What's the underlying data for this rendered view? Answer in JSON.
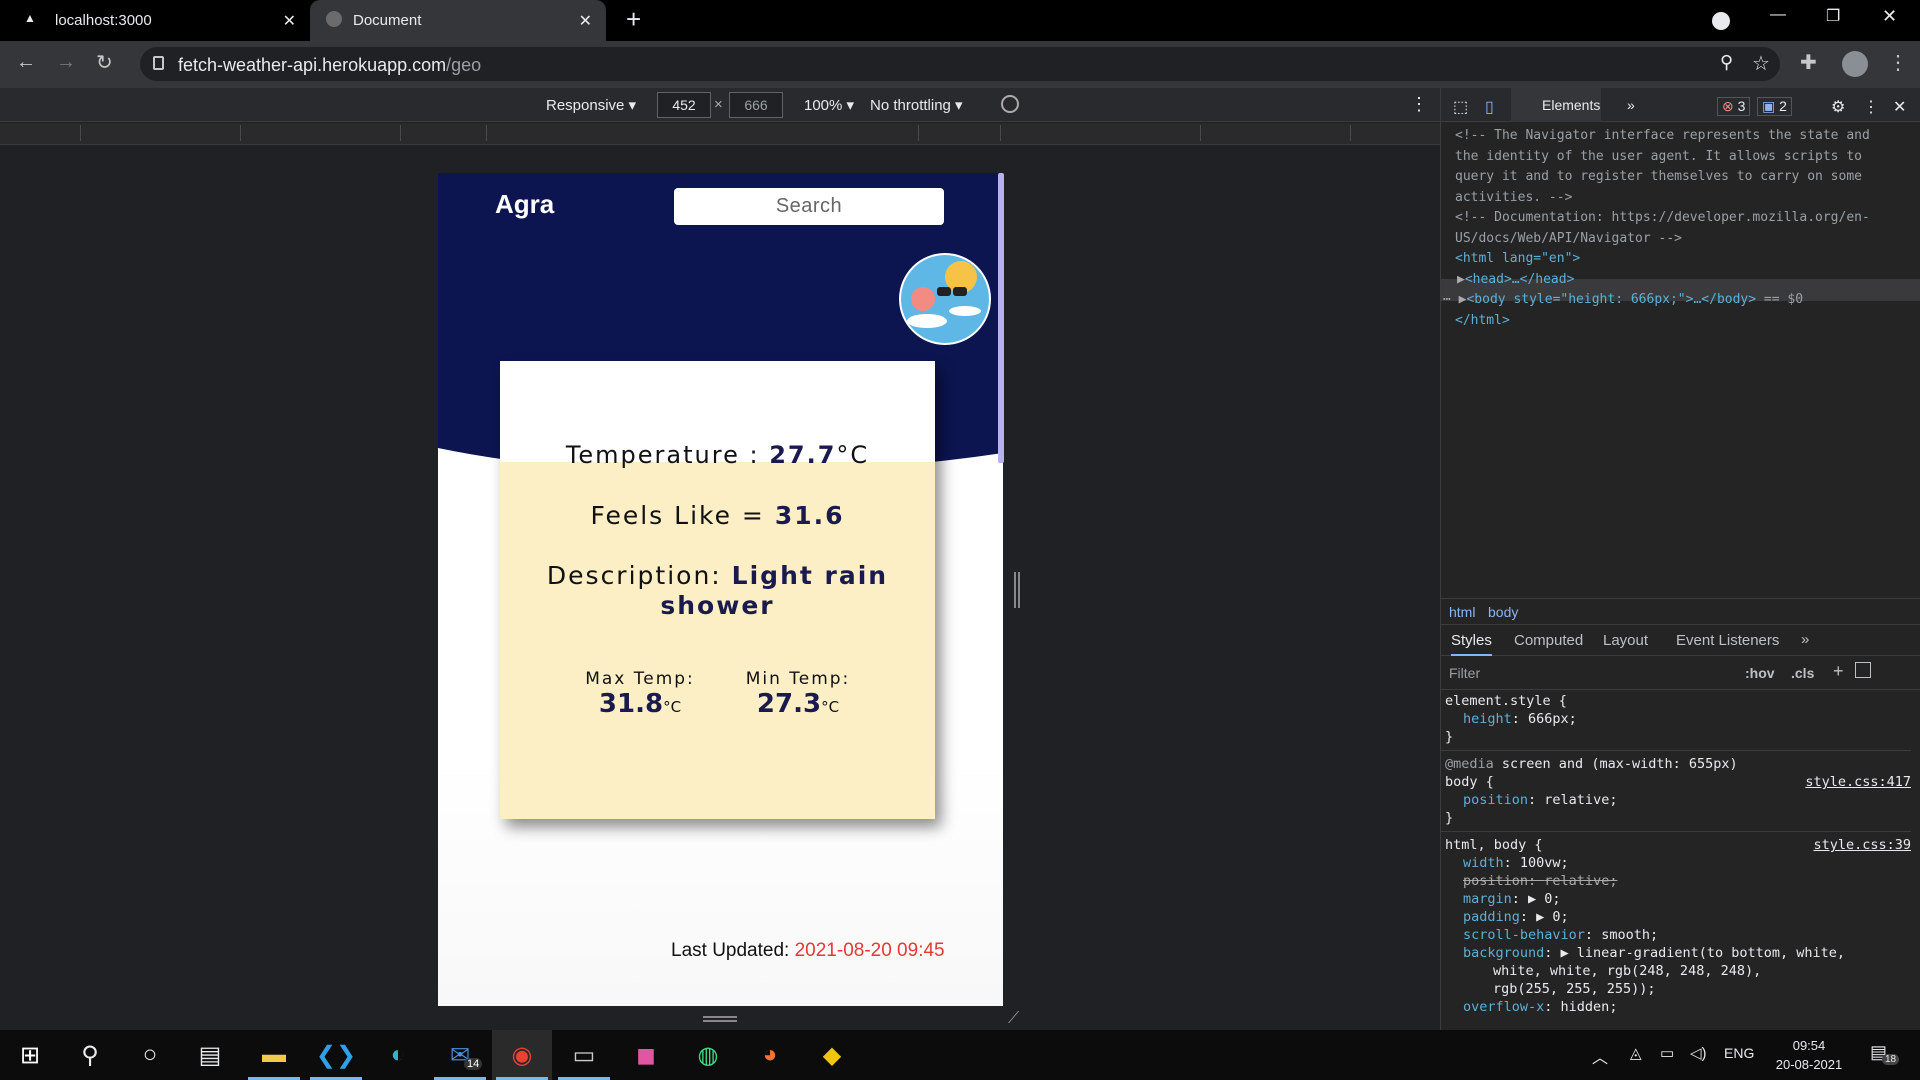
{
  "browser": {
    "tabs": [
      {
        "label": "localhost:3000",
        "close": "✕"
      },
      {
        "label": "Document",
        "close": "✕"
      }
    ],
    "new_tab": "+",
    "url_host": "fetch-weather-api.herokuapp.com",
    "url_path": "/geo"
  },
  "device_toolbar": {
    "preset": "Responsive",
    "width": "452",
    "times": "×",
    "height": "666",
    "zoom": "100%",
    "throttling": "No throttling"
  },
  "app": {
    "city": "Agra",
    "search_placeholder": "Search",
    "temperature_label": "Temperature :",
    "temperature_value": "27.7",
    "temperature_unit": "°C",
    "feels_like_label": "Feels Like =",
    "feels_like_value": "31.6",
    "description_label": "Description:",
    "description_value_line1": "Light rain",
    "description_value_line2": "shower",
    "max_label": "Max Temp:",
    "max_value": "31.8",
    "min_label": "Min Temp:",
    "min_value": "27.3",
    "unit_small": "°C",
    "last_updated_label": "Last Updated:",
    "last_updated_value": "2021-08-20 09:45"
  },
  "devtools": {
    "panel": "Elements",
    "more": "»",
    "errors": "3",
    "messages": "2",
    "dom_lines": [
      "<!-- The Navigator interface represents the state and",
      "the identity of the user agent. It allows scripts to",
      "query it and to register themselves to carry on some",
      "activities. -->",
      "<!-- Documentation: https://developer.mozilla.org/en-",
      "US/docs/Web/API/Navigator -->"
    ],
    "html_open": "<html lang=\"en\">",
    "head_line": "<head>…</head>",
    "body_line": "<body style=\"height: 666px;\">…</body>",
    "body_suffix": "== $0",
    "html_close": "</html>",
    "breadcrumbs": [
      "html",
      "body"
    ],
    "style_tabs": [
      "Styles",
      "Computed",
      "Layout",
      "Event Listeners"
    ],
    "filter_placeholder": "Filter",
    "hov": ":hov",
    "cls": ".cls",
    "element_style_selector": "element.style {",
    "element_style_prop": "height",
    "element_style_val": "666px;",
    "media_query": "@media screen and (max-width: 655px)",
    "body_selector": "body {",
    "body_source": "style.css:417",
    "body_prop": "position",
    "body_val": "relative;",
    "html_body_selector": "html, body {",
    "html_body_source": "style.css:39",
    "rules": [
      {
        "p": "width",
        "v": "100vw;"
      },
      {
        "p": "position",
        "v": "relative;"
      },
      {
        "p": "margin",
        "v": "▶ 0;"
      },
      {
        "p": "padding",
        "v": "▶ 0;"
      },
      {
        "p": "scroll-behavior",
        "v": "smooth;"
      },
      {
        "p": "background",
        "v": "▶ linear-gradient(to bottom, white,"
      },
      {
        "p": "",
        "v": "white, white, rgb(248, 248, 248),"
      },
      {
        "p": "",
        "v": "rgb(255, 255, 255));"
      },
      {
        "p": "overflow-x",
        "v": "hidden;"
      }
    ]
  },
  "taskbar": {
    "lang": "ENG",
    "time": "09:54",
    "date": "20-08-2021",
    "mail_badge": "14",
    "notif_badge": "18"
  },
  "colors": {
    "navy": "#0c1550",
    "card_cream": "#fcefc6",
    "timestamp_red": "#e53935"
  }
}
